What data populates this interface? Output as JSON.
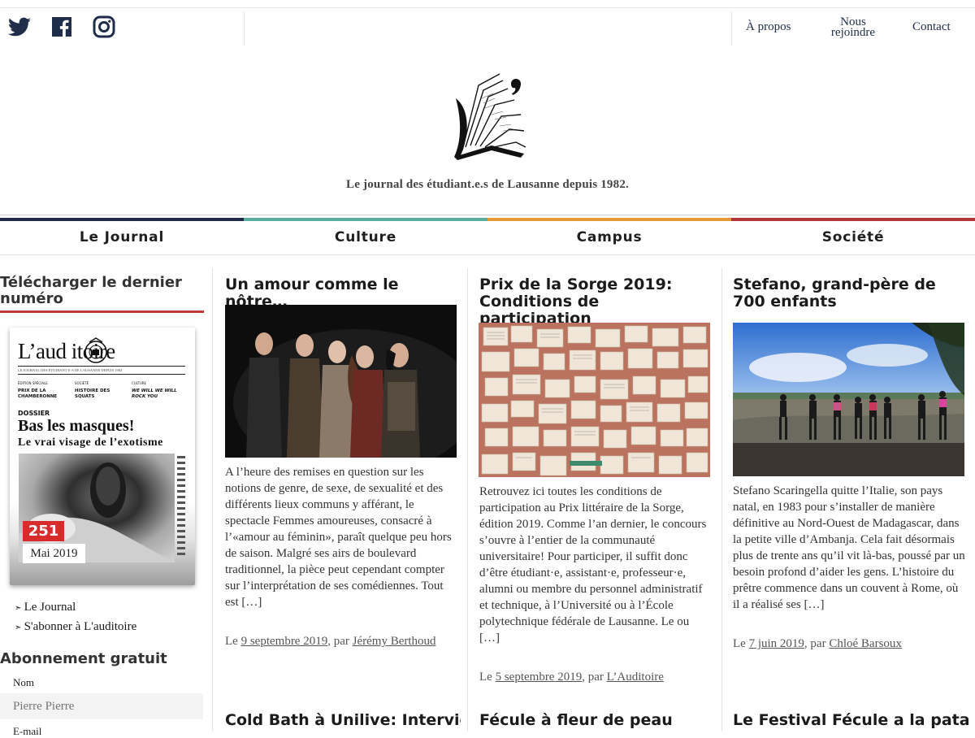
{
  "social": [
    {
      "name": "twitter-icon"
    },
    {
      "name": "facebook-icon"
    },
    {
      "name": "instagram-icon"
    }
  ],
  "topnav": {
    "about": "À propos",
    "join_line1": "Nous",
    "join_line2": "rejoindre",
    "contact": "Contact"
  },
  "site": {
    "tagline": "Le journal des étudiant.e.s de Lausanne depuis 1982."
  },
  "categories": [
    {
      "label": "Le Journal",
      "color": "#1f2a44"
    },
    {
      "label": "Culture",
      "color": "#5aaea0"
    },
    {
      "label": "Campus",
      "color": "#e59a3a"
    },
    {
      "label": "Société",
      "color": "#b3363d"
    }
  ],
  "sidebar": {
    "download_title": "Télécharger le dernier numéro",
    "cover": {
      "title": "L’aud   itoire",
      "subtitle": "LE JOURNAL DES ÉTUDIANT·E·S DE LAUSANNE DEPUIS 1982",
      "sections": [
        {
          "label": "ÉDITION SPÉCIALE",
          "text": "PRIX DE LA CHAMBERONNE"
        },
        {
          "label": "SOCIÉTÉ",
          "text": "HISTOIRE DES SQUATS"
        },
        {
          "label": "CULTURE",
          "text": "WE WILL WE WILL ROCK YOU"
        }
      ],
      "dossier": "DOSSIER",
      "headline": "Bas les masques!",
      "subhead": "Le vrai visage de l’exotisme",
      "issue_number": "251",
      "issue_date": "Mai 2019"
    },
    "links": [
      "Le Journal",
      "S'abonner à L'auditoire"
    ],
    "subscribe_title": "Abonnement gratuit",
    "name_label": "Nom",
    "name_placeholder": "Pierre Pierre",
    "email_label": "E-mail"
  },
  "articles": [
    {
      "title": "Un amour comme le nôtre…",
      "excerpt": "A l’heure des remises en question sur les notions de genre, de sexe, de sexualité et des différents lieux communs y afférant, le spectacle Femmes amoureuses, consacré à l’«amour au féminin», paraît quelque peu hors de saison. Malgré ses airs de boulevard traditionnel, la pièce peut cependant compter sur l’interprétation de ses comédiennes. Tout est […]",
      "meta_prefix": "Le",
      "date": "9 septembre 2019",
      "meta_mid": ", par",
      "author": "Jérémy Berthoud",
      "image": "dark-stage-photo"
    },
    {
      "title": "Prix de la Sorge 2019: Conditions de participation",
      "excerpt": "Retrouvez ici toutes les conditions de participation au Prix littéraire de la Sorge, édition 2019. Comme l’an dernier, le concours s’ouvre à l’entier de la communauté universitaire! Pour participer, il suffit donc d’être étudiant·e, assistant·e, professeur·e, alumni ou membre du personnel administratif et technique, à l’Université ou à l’École polytechnique fédérale de Lausanne. Le ou […]",
      "meta_prefix": "Le",
      "date": "5 septembre 2019",
      "meta_mid": ", par",
      "author": "L’Auditoire",
      "image": "open-books-photo"
    },
    {
      "title": "Stefano, grand-père de 700 enfants",
      "excerpt": "Stefano Scaringella quitte l’Italie, son pays natal, en 1983 pour s’installer de manière définitive au Nord-Ouest de Madagascar, dans la petite ville d’Ambanja. Cela fait désormais plus de trente ans qu’il vit là-bas, poussé par un besoin profond d’aider les gens. L’histoire du prêtre commence dans un couvent à Rome, où il a réalisé ses […]",
      "meta_prefix": "Le",
      "date": "7 juin 2019",
      "meta_mid": ", par",
      "author": "Chloé Barsoux",
      "image": "beach-children-photo"
    }
  ],
  "next_articles": [
    "Cold Bath à Unilive: Interview avec les deux têtes de Vaudou",
    "Fécule à fleur de peau",
    "Le Festival Fécule a la patate"
  ]
}
